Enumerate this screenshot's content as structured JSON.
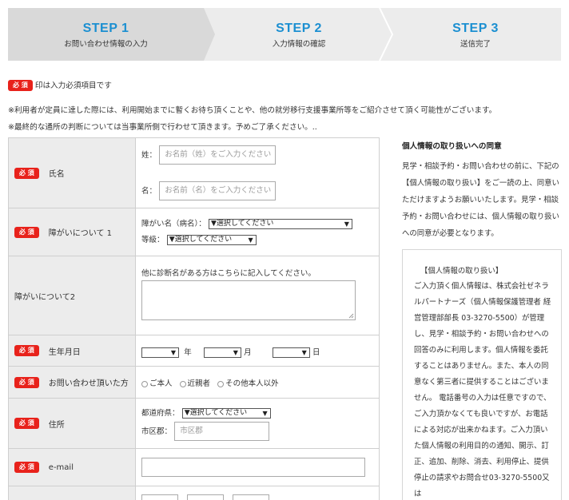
{
  "steps": [
    {
      "num": "STEP 1",
      "label": "お問い合わせ情報の入力"
    },
    {
      "num": "STEP 2",
      "label": "入力情報の確認"
    },
    {
      "num": "STEP 3",
      "label": "送信完了"
    }
  ],
  "required_badge": "必 須",
  "notes": {
    "required_legend": "印は入力必須項目です",
    "line1": "※利用者が定員に達した際には、利用開始までに暫くお待ち頂くことや、他の就労移行支援事業所等をご紹介させて頂く可能性がございます。",
    "line2": "※最終的な通所の判断については当事業所側で行わせて頂きます。予めご了承ください。.."
  },
  "form": {
    "name": {
      "label": "氏名",
      "sei_label": "姓：",
      "sei_placeholder": "お名前（姓）をご入力ください",
      "mei_label": "名：",
      "mei_placeholder": "お名前（名）をご入力ください"
    },
    "disability1": {
      "label": "障がいについて 1",
      "name_label": "障がい名（病名）：",
      "name_select": "▼選択してください",
      "grade_label": "等級：",
      "grade_select": "▼選択してください"
    },
    "disability2": {
      "label": "障がいについて2",
      "instruction": "他に診断名がある方はこちらに記入してください。"
    },
    "birthdate": {
      "label": "生年月日",
      "year_suffix": "年",
      "month_suffix": "月",
      "day_suffix": "日"
    },
    "inquirer": {
      "label": "お問い合わせ頂いた方",
      "options": [
        "ご本人",
        "近親者",
        "その他本人以外"
      ]
    },
    "address": {
      "label": "住所",
      "pref_label": "都道府県：",
      "pref_select": "▼選択してください",
      "city_label": "市区郡：",
      "city_placeholder": "市区郡"
    },
    "email": {
      "label": "e-mail"
    }
  },
  "privacy": {
    "title": "個人情報の取り扱いへの同意",
    "body": "見学・相談予約・お問い合わせの前に、下記の【個人情報の取り扱い】をご一読の上、同意いただけますようお願いいたします。見学・相談予約・お問い合わせには、個人情報の取り扱いへの同意が必要となります。",
    "box_title": "【個人情報の取り扱い】",
    "box_text": "ご入力頂く個人情報は、株式会社ゼネラルパートナーズ（個人情報保護管理者 経営管理部部長 03-3270-5500）が管理し、見学・相談予約・お問い合わせへの回答のみに利用します。個人情報を委託することはありません。また、本人の同意なく第三者に提供することはございません。 電話番号の入力は任意ですので、ご入力頂かなくても良いですが、お電話による対応が出来かねます。ご入力頂いた個人情報の利用目的の通知、開示、訂正、追加、削除、消去、利用停止、提供停止の請求やお問合せ03-3270-5500又は"
  },
  "colors": {
    "accent": "#1b8fd1",
    "required": "#e8221b",
    "header_bg": "#ececec"
  }
}
